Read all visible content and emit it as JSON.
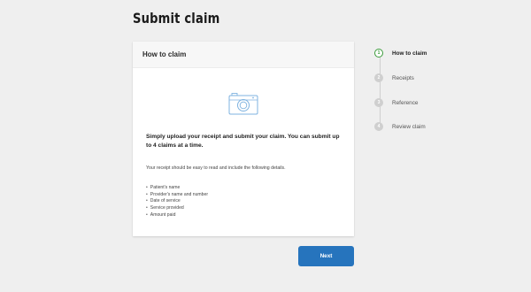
{
  "page": {
    "title": "Submit claim"
  },
  "card": {
    "header": "How to claim",
    "lead": "Simply upload your receipt and submit your claim. You can submit up to 4 claims at a time.",
    "sub": "Your receipt should be easy to read and include the following details.",
    "details": [
      "Patient's name",
      "Provider's name and number",
      "Date of service",
      "Service provided",
      "Amount paid"
    ],
    "icon": "camera-icon"
  },
  "actions": {
    "next_label": "Next"
  },
  "stepper": {
    "steps": [
      {
        "number": "1",
        "label": "How to claim",
        "active": true
      },
      {
        "number": "2",
        "label": "Receipts",
        "active": false
      },
      {
        "number": "3",
        "label": "Reference",
        "active": false
      },
      {
        "number": "4",
        "label": "Review claim",
        "active": false
      }
    ]
  },
  "colors": {
    "accent": "#2674bd",
    "active_step": "#3a9b3a",
    "inactive_step": "#cfcfcf",
    "icon": "#7fb3e0"
  }
}
